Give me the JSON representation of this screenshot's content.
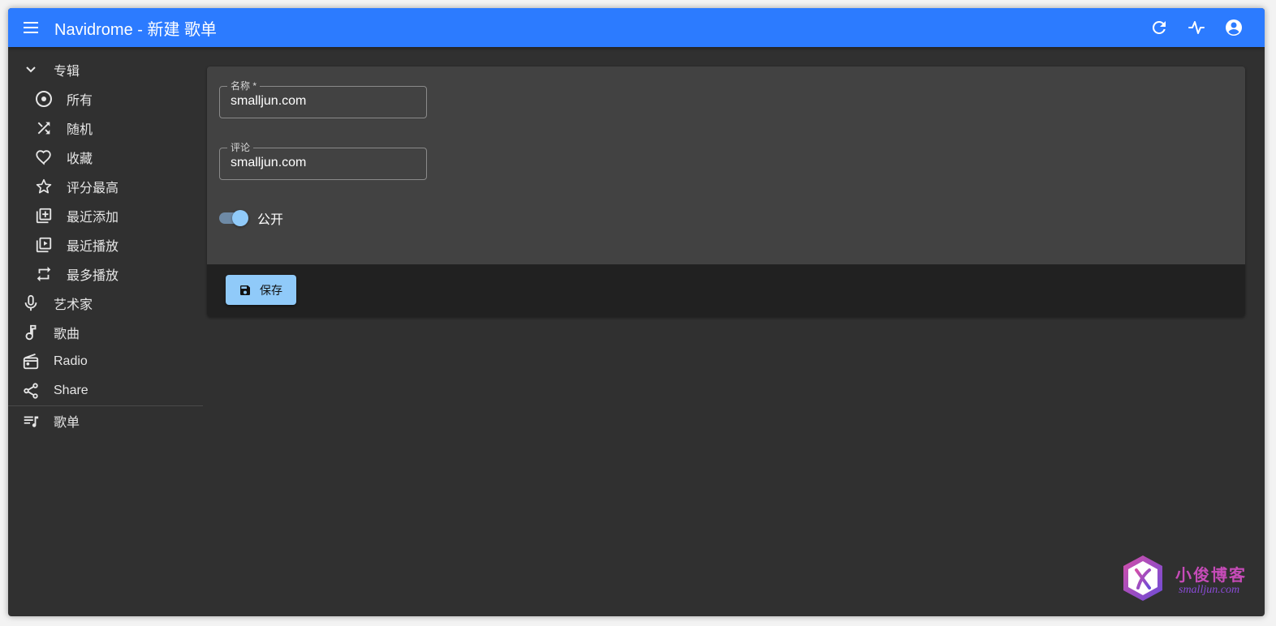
{
  "appbar": {
    "title": "Navidrome - 新建 歌单",
    "color": "#2c7bff"
  },
  "sidebar": {
    "albums_group": "专辑",
    "album_items": [
      {
        "label": "所有",
        "icon": "album-disc-icon"
      },
      {
        "label": "随机",
        "icon": "shuffle-icon"
      },
      {
        "label": "收藏",
        "icon": "heart-icon"
      },
      {
        "label": "评分最高",
        "icon": "star-icon"
      },
      {
        "label": "最近添加",
        "icon": "library-add-icon"
      },
      {
        "label": "最近播放",
        "icon": "video-library-icon"
      },
      {
        "label": "最多播放",
        "icon": "repeat-icon"
      }
    ],
    "artists": "艺术家",
    "songs": "歌曲",
    "radio": "Radio",
    "share": "Share",
    "playlists": "歌单"
  },
  "form": {
    "name_label": "名称 *",
    "name_value": "smalljun.com",
    "comment_label": "评论",
    "comment_value": "smalljun.com",
    "public_label": "公开",
    "public_on": true,
    "save_label": "保存",
    "save_color": "#90caf9"
  },
  "watermark": {
    "cn": "小俊博客",
    "en": "smalljun.com"
  }
}
